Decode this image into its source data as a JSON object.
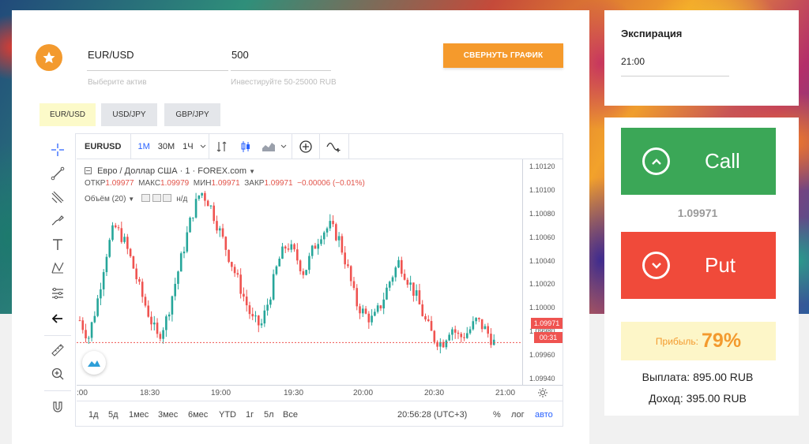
{
  "asset": {
    "value": "EUR/USD",
    "hint": "Выберите актив"
  },
  "investment": {
    "value": "500",
    "hint": "Инвестируйте 50-25000 RUB"
  },
  "collapse_chart_label": "СВЕРНУТЬ ГРАФИК",
  "pair_tabs": [
    {
      "label": "EUR/USD",
      "active": true
    },
    {
      "label": "USD/JPY",
      "active": false
    },
    {
      "label": "GBP/JPY",
      "active": false
    }
  ],
  "chart_toolbar": {
    "symbol": "EURUSD",
    "intervals": [
      "1M",
      "30M",
      "1Ч"
    ]
  },
  "chart_legend": {
    "title": "Евро / Доллар США · 1 · FOREX.com",
    "open_label": "ОТКР",
    "open": "1.09977",
    "high_label": "МАКС",
    "high": "1.09979",
    "low_label": "МИН",
    "low": "1.09971",
    "close_label": "ЗАКР",
    "close": "1.09971",
    "change": "−0.00006 (−0.01%)",
    "volume": "Объём (20)",
    "volume_value": "н/д"
  },
  "current_price_label": "1.09971",
  "countdown": "00:31",
  "bottom_bar": {
    "ranges": [
      "1д",
      "5д",
      "1мес",
      "3мес",
      "6мес",
      "YTD",
      "1г",
      "5л",
      "Все"
    ],
    "clock": "20:56:28 (UTC+3)",
    "percent": "%",
    "log": "лог",
    "auto": "авто"
  },
  "chart_data": {
    "type": "candlestick",
    "symbol": "EURUSD",
    "y_ticks": [
      "1.10120",
      "1.10100",
      "1.10080",
      "1.10060",
      "1.10040",
      "1.10020",
      "1.10000",
      "1.09980",
      "1.09960",
      "1.09940"
    ],
    "y_range": [
      1.09935,
      1.10127
    ],
    "x_ticks": [
      ":00",
      "18:30",
      "19:00",
      "19:30",
      "20:00",
      "20:30",
      "21:00"
    ],
    "current_price": 1.09971,
    "series_close": [
      1.0999,
      1.09975,
      1.10005,
      1.10045,
      1.1007,
      1.1006,
      1.1004,
      1.10015,
      1.09995,
      1.09975,
      1.0999,
      1.1002,
      1.1005,
      1.1008,
      1.101,
      1.1009,
      1.1007,
      1.1005,
      1.1003,
      1.1001,
      1.0999,
      1.09985,
      1.1001,
      1.1004,
      1.10055,
      1.10045,
      1.1003,
      1.1005,
      1.10065,
      1.1007,
      1.1006,
      1.10035,
      1.10005,
      1.09995,
      1.0999,
      1.10005,
      1.10025,
      1.1004,
      1.10025,
      1.1001,
      1.0999,
      1.09975,
      1.0997,
      1.09985,
      1.09975,
      1.0998,
      1.0999,
      1.09982,
      1.09971
    ]
  },
  "expiry": {
    "title": "Экспирация",
    "value": "21:00"
  },
  "call": {
    "label": "Call"
  },
  "put": {
    "label": "Put"
  },
  "price_display": "1.09971",
  "profit": {
    "label": "Прибыль:",
    "value": "79%"
  },
  "payout": "Выплата: 895.00 RUB",
  "income": "Доход: 395.00 RUB",
  "colors": {
    "up": "#26a69a",
    "down": "#ef5350",
    "accent": "#f59a2c",
    "call": "#3ba757",
    "put": "#f04a3a"
  }
}
